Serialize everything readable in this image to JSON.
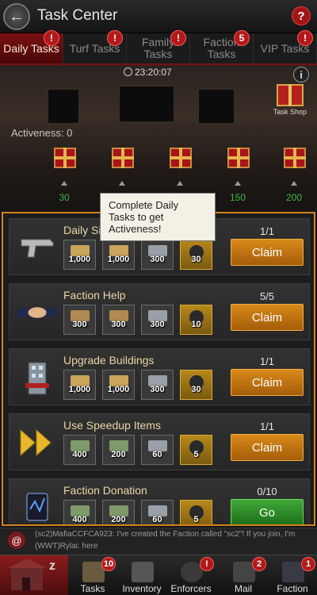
{
  "header": {
    "title": "Task Center",
    "back_icon": "back-arrow-icon",
    "help_label": "?"
  },
  "tabs": [
    {
      "label": "Daily Tasks",
      "badge": "!",
      "active": true
    },
    {
      "label": "Turf Tasks",
      "badge": "!"
    },
    {
      "label": "Family Tasks",
      "badge": "!"
    },
    {
      "label": "Faction Tasks",
      "badge": "5"
    },
    {
      "label": "VIP Tasks",
      "badge": "!"
    }
  ],
  "scene": {
    "timer": "23:20:07",
    "info_label": "i",
    "shop_label": "Task Shop",
    "activeness_label": "Activeness: 0",
    "thresholds": [
      "30",
      "",
      "",
      "150",
      "200"
    ]
  },
  "tooltip": {
    "text": "Complete Daily Tasks to get Activeness!"
  },
  "tasks": [
    {
      "name": "Daily Sign-in",
      "icon": "pistol-icon",
      "rewards": [
        {
          "qty": "1,000",
          "kind": "food-icon"
        },
        {
          "qty": "1,000",
          "kind": "food-icon"
        },
        {
          "qty": "300",
          "kind": "steel-icon"
        },
        {
          "qty": "30",
          "kind": "time-icon"
        }
      ],
      "progress": "1/1",
      "button": "Claim"
    },
    {
      "name": "Faction Help",
      "icon": "handshake-icon",
      "rewards": [
        {
          "qty": "300",
          "kind": "crates-icon"
        },
        {
          "qty": "300",
          "kind": "crates-icon"
        },
        {
          "qty": "300",
          "kind": "steel-icon"
        },
        {
          "qty": "10",
          "kind": "time-icon"
        }
      ],
      "progress": "5/5",
      "button": "Claim"
    },
    {
      "name": "Upgrade Buildings",
      "icon": "building-icon",
      "rewards": [
        {
          "qty": "1,000",
          "kind": "food-icon"
        },
        {
          "qty": "1,000",
          "kind": "food-icon"
        },
        {
          "qty": "300",
          "kind": "steel-icon"
        },
        {
          "qty": "30",
          "kind": "time-icon"
        }
      ],
      "progress": "1/1",
      "button": "Claim"
    },
    {
      "name": "Use Speedup Items",
      "icon": "speedup-arrows-icon",
      "rewards": [
        {
          "qty": "400",
          "kind": "cash-icon"
        },
        {
          "qty": "200",
          "kind": "cash-icon"
        },
        {
          "qty": "60",
          "kind": "steel-icon"
        },
        {
          "qty": "5",
          "kind": "time-icon"
        }
      ],
      "progress": "1/1",
      "button": "Claim"
    },
    {
      "name": "Faction Donation",
      "icon": "tablet-icon",
      "rewards": [
        {
          "qty": "400",
          "kind": "cash-icon"
        },
        {
          "qty": "200",
          "kind": "cash-icon"
        },
        {
          "qty": "60",
          "kind": "steel-icon"
        },
        {
          "qty": "5",
          "kind": "time-icon"
        }
      ],
      "progress": "0/10",
      "button": "Go"
    }
  ],
  "chat": {
    "line1": "(sc2)MafiaCCFCA923: I've created the Faction called \"sc2\"! If you join, I'm",
    "line2": "(WWT)Rylai: here"
  },
  "nav": {
    "items": [
      {
        "label": "Tasks",
        "badge": "10"
      },
      {
        "label": "Inventory",
        "badge": ""
      },
      {
        "label": "Enforcers",
        "badge": "!"
      },
      {
        "label": "Mail",
        "badge": "2"
      },
      {
        "label": "Faction",
        "badge": "1"
      }
    ]
  },
  "colors": {
    "accent_orange": "#d4831c",
    "claim_button": "#c27a14",
    "go_button": "#37a030",
    "badge_red": "#b21a1a",
    "threshold_green": "#3fb73f"
  }
}
